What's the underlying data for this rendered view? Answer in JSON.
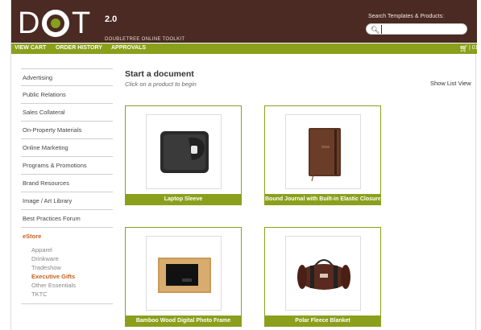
{
  "header": {
    "logo_d": "D",
    "logo_t": "T",
    "version": "2.0",
    "subtitle": "DOUBLETREE ONLINE TOOLKIT",
    "search_label": "Search Templates & Products:",
    "search_value": ""
  },
  "nav": {
    "view_cart": "VIEW CART",
    "order_history": "ORDER HISTORY",
    "approvals": "APPROVALS",
    "cart_count": "| 01"
  },
  "sidebar": {
    "items": [
      "Advertising",
      "Public Relations",
      "Sales Collateral",
      "On-Property Materials",
      "Online Marketing",
      "Programs & Promotions",
      "Brand Resources",
      "Image / Art Library",
      "Best Practices Forum"
    ],
    "estore": "eStore",
    "sub_items": [
      "Apparel",
      "Drinkware",
      "Tradeshow",
      "Executive Gifts",
      "Other Essentials",
      "TKTC"
    ]
  },
  "main": {
    "title": "Start a document",
    "subtitle": "Click on a product to begin",
    "list_view": "Show List View",
    "products": [
      "Laptop Sleeve",
      "Bound Journal with Built-in Elastic Closure",
      "Bamboo Wood Digital Photo Frame",
      "Polar Fleece Blanket"
    ]
  },
  "colors": {
    "header_bg": "#4a2a22",
    "accent_green": "#8aa01c",
    "accent_orange": "#c8601c"
  }
}
